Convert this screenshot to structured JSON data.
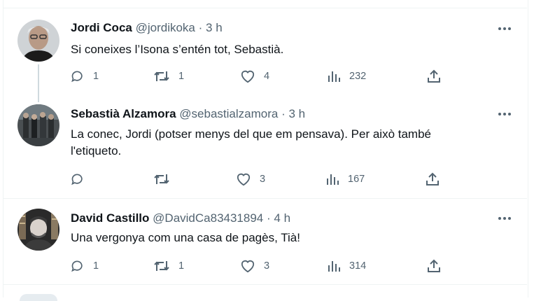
{
  "tweets": [
    {
      "name": "Jordi Coca",
      "handle": "@jordikoka",
      "dot": "·",
      "time": "3 h",
      "text": "Si coneixes l’Isona s’entén tot, Sebastià.",
      "replies": "1",
      "retweets": "1",
      "likes": "4",
      "views": "232"
    },
    {
      "name": "Sebastià Alzamora",
      "handle": "@sebastialzamora",
      "dot": "·",
      "time": "3 h",
      "text_line1": "La conec, Jordi (potser menys del que em pensava). Per això també",
      "text_line2": "l'etiqueto.",
      "replies": "",
      "retweets": "",
      "likes": "3",
      "views": "167"
    },
    {
      "name": "David Castillo",
      "handle": "@DavidCa83431894",
      "dot": "·",
      "time": "4 h",
      "text": "Una vergonya com una casa de pagès, Tià!",
      "replies": "1",
      "retweets": "1",
      "likes": "3",
      "views": "314"
    }
  ],
  "icons": {
    "reply": "reply-icon",
    "retweet": "retweet-icon",
    "like": "heart-icon",
    "views": "views-icon",
    "share": "share-icon",
    "more": "more-icon"
  },
  "colors": {
    "text": "#0f1419",
    "secondary": "#536471",
    "border": "#eff3f4",
    "thread_line": "#cfd9de"
  }
}
